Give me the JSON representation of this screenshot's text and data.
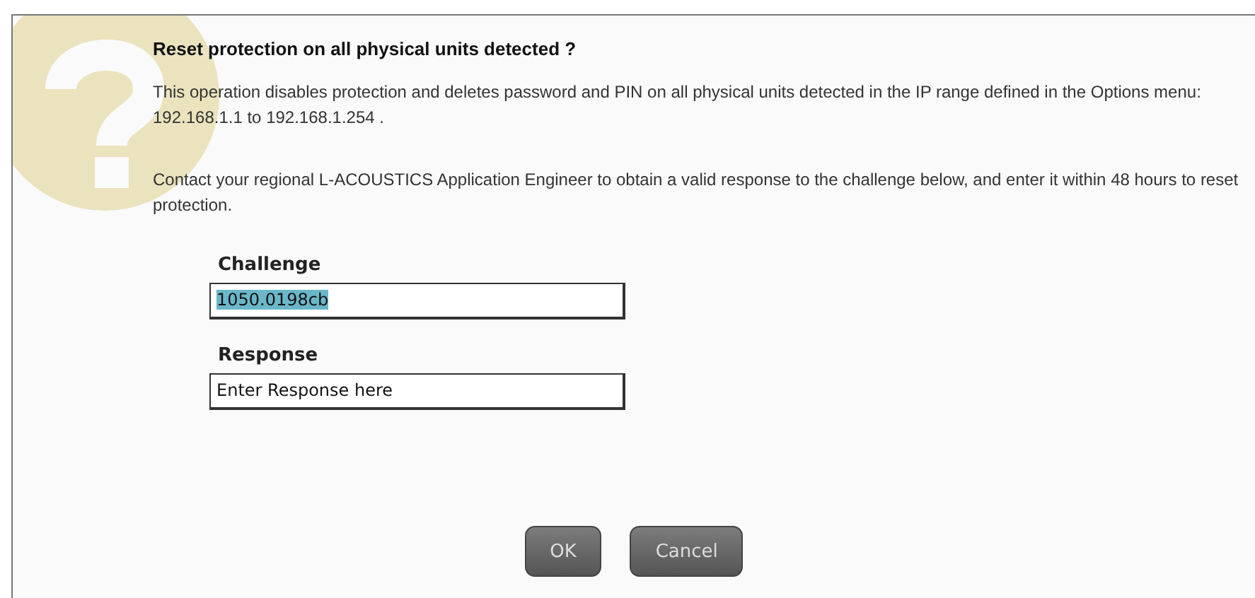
{
  "dialog": {
    "title": "Reset protection on all physical units detected ?",
    "paragraphs": [
      "This operation disables protection and deletes password and PIN on all physical units detected in the IP range defined in the Options menu: 192.168.1.1 to 192.168.1.254 .",
      "Contact your regional L-ACOUSTICS Application Engineer to obtain a valid response to the challenge below, and enter it within 48 hours to reset protection."
    ],
    "fields": [
      {
        "label": "Challenge",
        "value": "1050.0198cb",
        "selected": true
      },
      {
        "label": "Response",
        "value": "Enter Response here",
        "selected": false
      }
    ],
    "buttons": [
      "OK",
      "Cancel"
    ]
  }
}
